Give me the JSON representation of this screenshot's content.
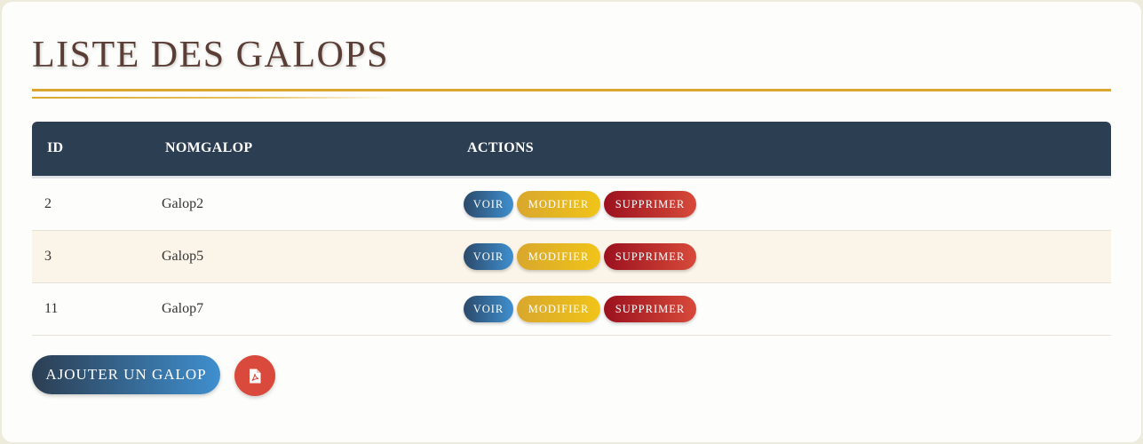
{
  "page": {
    "title": "LISTE DES GALOPS"
  },
  "table": {
    "headers": {
      "id": "ID",
      "name": "NOMGALOP",
      "actions": "ACTIONS"
    },
    "rows": [
      {
        "id": "2",
        "name": "Galop2"
      },
      {
        "id": "3",
        "name": "Galop5"
      },
      {
        "id": "11",
        "name": "Galop7"
      }
    ],
    "action_labels": {
      "view": "VOIR",
      "edit": "MODIFIER",
      "delete": "SUPPRIMER"
    }
  },
  "footer": {
    "add_label": "AJOUTER UN GALOP",
    "pdf_icon": "file-pdf-icon"
  },
  "colors": {
    "title": "#5a3e36",
    "accent_gold": "#d9a72d",
    "header_bg": "#2c3e52",
    "view_btn": "#3f8fcf",
    "edit_btn": "#f0c419",
    "delete_btn": "#c8302f",
    "pdf_btn": "#d94a3d",
    "alt_row_bg": "#fbf4e8"
  }
}
